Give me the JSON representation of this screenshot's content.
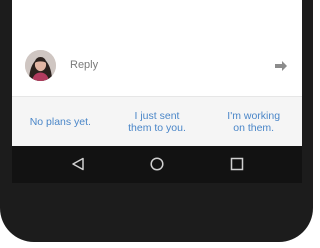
{
  "reply": {
    "label": "Reply",
    "avatar_icon": "profile-photo",
    "send_icon": "arrow-right-icon"
  },
  "suggestions": [
    {
      "text": "No plans yet."
    },
    {
      "text": "I just sent\nthem to you."
    },
    {
      "text": "I'm working\non them."
    }
  ],
  "navigation": {
    "back_icon": "triangle-back-icon",
    "home_icon": "circle-home-icon",
    "recent_icon": "square-recents-icon"
  },
  "colors": {
    "suggestion_text": "#4a86c8",
    "nav_bar": "#121212",
    "device_frame": "#1c1c1c"
  }
}
